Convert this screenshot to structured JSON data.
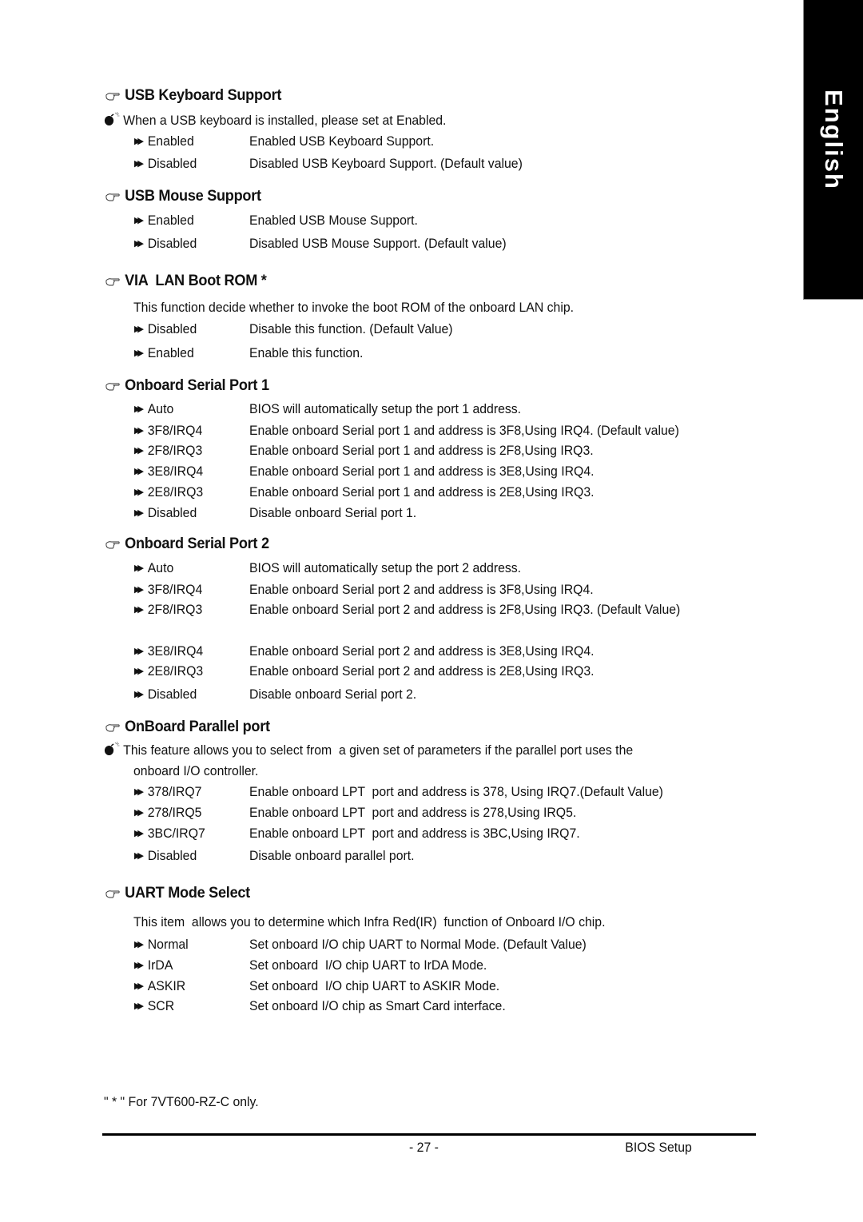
{
  "language_tab": "English",
  "sections": [
    {
      "title": "USB Keyboard Support",
      "note": "When a USB keyboard is installed, please set at Enabled.",
      "options": [
        {
          "value": "Enabled",
          "description": "Enabled USB Keyboard Support."
        },
        {
          "value": "Disabled",
          "description": "Disabled USB Keyboard Support. (Default value)"
        }
      ]
    },
    {
      "title": "USB Mouse Support",
      "options": [
        {
          "value": "Enabled",
          "description": "Enabled USB Mouse Support."
        },
        {
          "value": "Disabled",
          "description": "Disabled USB Mouse Support. (Default value)"
        }
      ]
    },
    {
      "title": "VIA  LAN Boot ROM *",
      "paragraph": "This function decide whether to invoke the boot ROM of the onboard LAN chip.",
      "options": [
        {
          "value": "Disabled",
          "description": "Disable this function. (Default Value)"
        },
        {
          "value": "Enabled",
          "description": "Enable this function."
        }
      ]
    },
    {
      "title": "Onboard Serial Port 1",
      "options": [
        {
          "value": "Auto",
          "description": "BIOS will automatically setup the port 1 address."
        },
        {
          "value": "3F8/IRQ4",
          "description": "Enable onboard Serial port 1 and address is 3F8,Using IRQ4. (Default value)"
        },
        {
          "value": "2F8/IRQ3",
          "description": "Enable onboard Serial port 1 and address is 2F8,Using IRQ3."
        },
        {
          "value": "3E8/IRQ4",
          "description": "Enable onboard Serial port 1 and address is 3E8,Using IRQ4."
        },
        {
          "value": "2E8/IRQ3",
          "description": "Enable onboard Serial port 1 and address is 2E8,Using IRQ3."
        },
        {
          "value": "Disabled",
          "description": "Disable onboard Serial port 1."
        }
      ]
    },
    {
      "title": "Onboard Serial Port 2",
      "options": [
        {
          "value": "Auto",
          "description": "BIOS will automatically setup the port 2 address."
        },
        {
          "value": "3F8/IRQ4",
          "description": "Enable onboard Serial port 2 and address is 3F8,Using IRQ4."
        },
        {
          "value": "2F8/IRQ3",
          "description": "Enable onboard Serial port 2 and address is 2F8,Using IRQ3. (Default Value)"
        },
        {
          "value": "3E8/IRQ4",
          "description": "Enable onboard Serial port 2 and address is 3E8,Using IRQ4."
        },
        {
          "value": "2E8/IRQ3",
          "description": "Enable onboard Serial port 2 and address is 2E8,Using IRQ3."
        },
        {
          "value": "Disabled",
          "description": "Disable onboard Serial port 2."
        }
      ]
    },
    {
      "title": "OnBoard Parallel port",
      "note": "This feature allows you to select from  a given set of parameters if the parallel port uses the",
      "note_cont": "onboard I/O controller.",
      "options": [
        {
          "value": "378/IRQ7",
          "description": "Enable onboard LPT  port and address is 378, Using IRQ7.(Default Value)"
        },
        {
          "value": "278/IRQ5",
          "description": "Enable onboard LPT  port and address is 278,Using IRQ5."
        },
        {
          "value": "3BC/IRQ7",
          "description": "Enable onboard LPT  port and address is 3BC,Using IRQ7."
        },
        {
          "value": "Disabled",
          "description": "Disable onboard parallel port."
        }
      ]
    },
    {
      "title": "UART Mode Select",
      "paragraph": "This item  allows you to determine which Infra Red(IR)  function of Onboard I/O chip.",
      "options": [
        {
          "value": "Normal",
          "description": "Set onboard I/O chip UART to Normal Mode. (Default Value)"
        },
        {
          "value": "IrDA",
          "description": "Set onboard  I/O chip UART to IrDA Mode."
        },
        {
          "value": "ASKIR",
          "description": "Set onboard  I/O chip UART to ASKIR Mode."
        },
        {
          "value": "SCR",
          "description": "Set onboard I/O chip as Smart Card interface."
        }
      ]
    }
  ],
  "footnote": "\" * \" For 7VT600-RZ-C only.",
  "footer": {
    "page_number": "- 27 -",
    "title": "BIOS Setup"
  },
  "icons": {
    "heading": "pointing-hand-icon",
    "note": "bomb-icon",
    "option": "double-arrow-icon"
  }
}
